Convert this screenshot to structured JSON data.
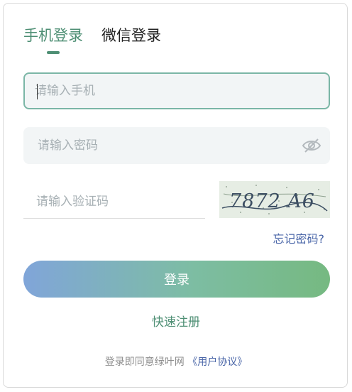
{
  "tabs": [
    {
      "label": "手机登录",
      "active": true
    },
    {
      "label": "微信登录",
      "active": false
    }
  ],
  "phone": {
    "placeholder": "请输入手机"
  },
  "password": {
    "placeholder": "请输入密码",
    "icon": "eye-off-icon"
  },
  "captcha": {
    "placeholder": "请输入验证码",
    "code": "7872 A6"
  },
  "forgot_label": "忘记密码?",
  "login_label": "登录",
  "register_label": "快速注册",
  "agreement": {
    "prefix": "登录即同意绿叶网",
    "link": "《用户协议》"
  },
  "colors": {
    "accent": "#4e8f74",
    "link": "#4a66a8",
    "gradient_start": "#80a5d9",
    "gradient_end": "#76b981"
  }
}
